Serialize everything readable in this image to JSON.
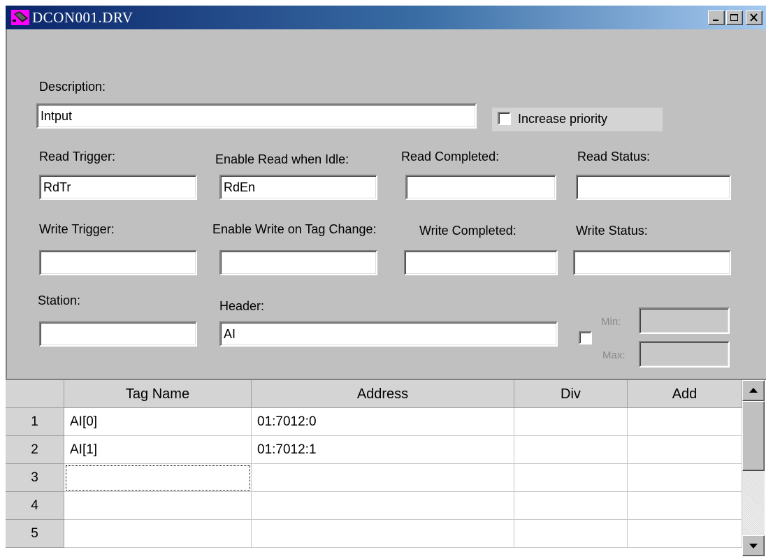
{
  "window": {
    "title": "DCON001.DRV",
    "controls": [
      "minimize",
      "maximize",
      "close"
    ]
  },
  "form": {
    "description_label": "Description:",
    "description_value": "Intput",
    "increase_priority_label": "Increase priority",
    "increase_priority_checked": false,
    "read_trigger_label": "Read Trigger:",
    "read_trigger_value": "RdTr",
    "enable_read_label": "Enable Read when Idle:",
    "enable_read_value": "RdEn",
    "read_completed_label": "Read Completed:",
    "read_completed_value": "",
    "read_status_label": "Read Status:",
    "read_status_value": "",
    "write_trigger_label": "Write Trigger:",
    "write_trigger_value": "",
    "enable_write_label": "Enable Write on Tag Change:",
    "enable_write_value": "",
    "write_completed_label": "Write Completed:",
    "write_completed_value": "",
    "write_status_label": "Write Status:",
    "write_status_value": "",
    "station_label": "Station:",
    "station_value": "",
    "header_label": "Header:",
    "header_value": "AI",
    "minmax_checked": false,
    "min_label": "Min:",
    "min_value": "",
    "max_label": "Max:",
    "max_value": ""
  },
  "table": {
    "columns": [
      "Tag Name",
      "Address",
      "Div",
      "Add"
    ],
    "rows": [
      {
        "num": "1",
        "tag": "AI[0]",
        "address": "01:7012:0",
        "div": "",
        "add": ""
      },
      {
        "num": "2",
        "tag": "AI[1]",
        "address": "01:7012:1",
        "div": "",
        "add": ""
      },
      {
        "num": "3",
        "tag": "",
        "address": "",
        "div": "",
        "add": ""
      },
      {
        "num": "4",
        "tag": "",
        "address": "",
        "div": "",
        "add": ""
      },
      {
        "num": "5",
        "tag": "",
        "address": "",
        "div": "",
        "add": ""
      }
    ]
  },
  "colors": {
    "title_start": "#0a246a",
    "title_end": "#a6caf0",
    "face": "#c0c0c0"
  }
}
